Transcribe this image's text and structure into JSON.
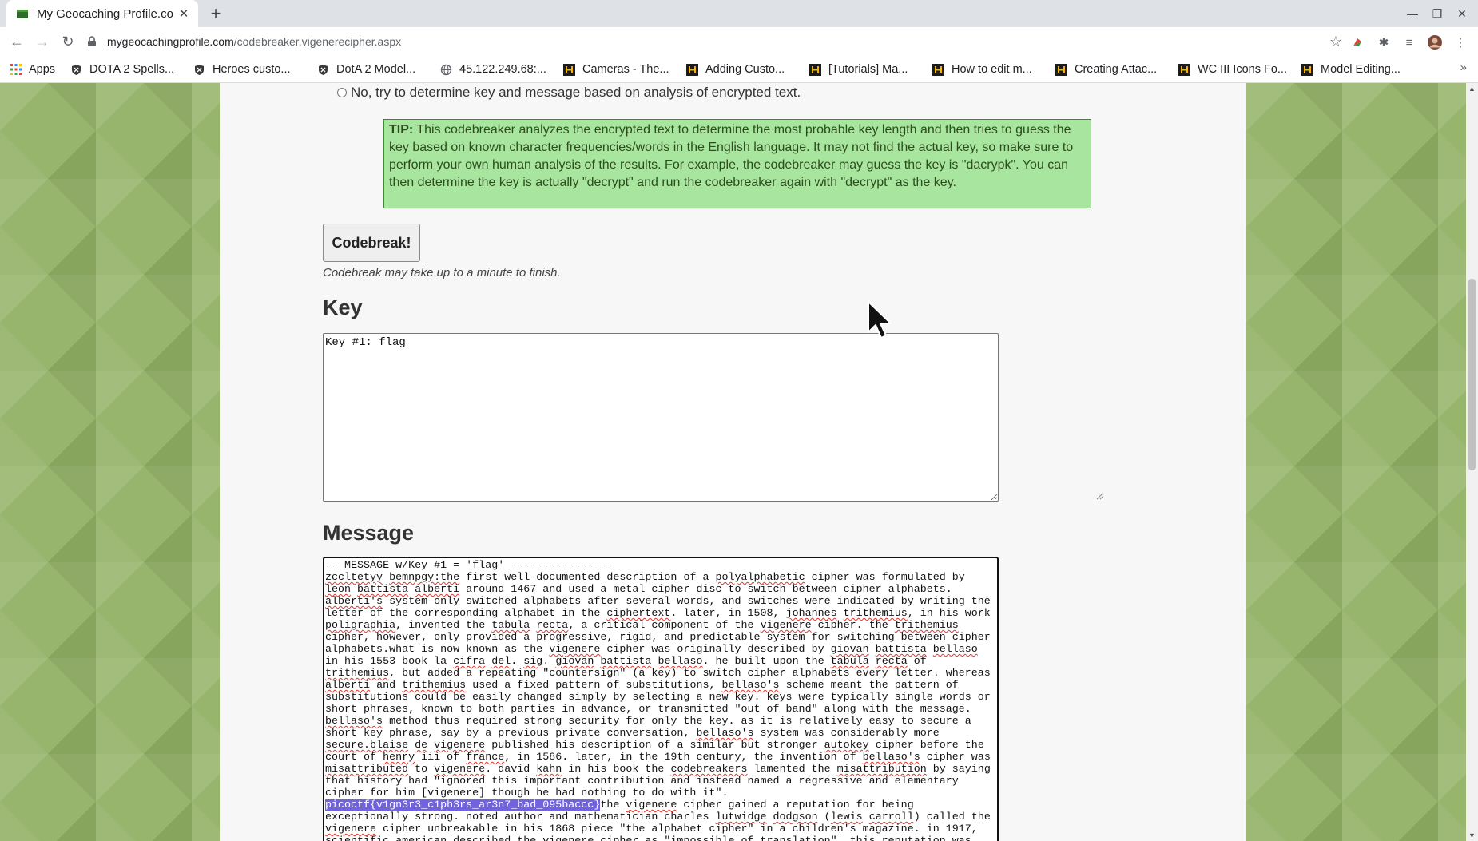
{
  "browser": {
    "tab_title": "My Geocaching Profile.co",
    "url_host": "mygeocachingprofile.com",
    "url_path": "/codebreaker.vigenerecipher.aspx",
    "bookmarks": [
      {
        "label": "Apps",
        "icon": "apps-grid-icon"
      },
      {
        "label": "DOTA 2 Spells...",
        "icon": "dota-shield-icon"
      },
      {
        "label": "Heroes custo...",
        "icon": "dota-shield-icon"
      },
      {
        "label": "DotA 2 Model...",
        "icon": "dota-shield-icon"
      },
      {
        "label": "45.122.249.68:...",
        "icon": "globe-icon"
      },
      {
        "label": "Cameras - The...",
        "icon": "hive-icon"
      },
      {
        "label": "Adding Custo...",
        "icon": "hive-icon"
      },
      {
        "label": "[Tutorials] Ma...",
        "icon": "hive-icon"
      },
      {
        "label": "How to edit m...",
        "icon": "hive-icon"
      },
      {
        "label": "Creating Attac...",
        "icon": "hive-icon"
      },
      {
        "label": "WC III Icons Fo...",
        "icon": "hive-icon"
      },
      {
        "label": "Model Editing...",
        "icon": "hive-icon"
      }
    ],
    "bookmarks_more": "»"
  },
  "page": {
    "radio_label": "No, try to determine key and message based on analysis of encrypted text.",
    "tip_label": "TIP:",
    "tip_text": " This codebreaker analyzes the encrypted text to determine the most probable key length and then tries to guess the key based on known character frequencies/words in the English language.  It may not find the actual key, so make sure to perform your own human analysis of the results.  For example, the codebreaker may guess the key is \"dacrypk\".  You can then determine the key is actually \"decrypt\" and run the codebreaker again with \"decrypt\" as the key.",
    "codebreak_button": "Codebreak!",
    "codebreak_note": "Codebreak may take up to a minute to finish.",
    "key_heading": "Key",
    "key_value": "Key #1: flag",
    "message_heading": "Message",
    "message_lines": [
      "-- MESSAGE w/Key #1 = 'flag' ----------------",
      "zccltetyy bemnpgy:the first well-documented description of a polyalphabetic cipher was formulated by",
      "leon battista alberti around 1467 and used a metal cipher disc to switch between cipher alphabets.",
      "alberti's system only switched alphabets after several words, and switches were indicated by writing the",
      "letter of the corresponding alphabet in the ciphertext. later, in 1508, johannes trithemius, in his work",
      "poligraphia, invented the tabula recta, a critical component of the vigenere cipher. the trithemius",
      "cipher, however, only provided a progressive, rigid, and predictable system for switching between cipher",
      "alphabets.what is now known as the vigenere cipher was originally described by giovan battista bellaso",
      "in his 1553 book la cifra del. sig. giovan battista bellaso. he built upon the tabula recta of",
      "trithemius, but added a repeating \"countersign\" (a key) to switch cipher alphabets every letter. whereas",
      "alberti and trithemius used a fixed pattern of substitutions, bellaso's scheme meant the pattern of",
      "substitutions could be easily changed simply by selecting a new key. keys were typically single words or",
      "short phrases, known to both parties in advance, or transmitted \"out of band\" along with the message.",
      "bellaso's method thus required strong security for only the key. as it is relatively easy to secure a",
      "short key phrase, say by a previous private conversation, bellaso's system was considerably more",
      "secure.blaise de vigenere published his description of a similar but stronger autokey cipher before the",
      "court of henry iii of france, in 1586. later, in the 19th century, the invention of bellaso's cipher was",
      "misattributed to vigenere. david kahn in his book the codebreakers lamented the misattribution by saying",
      "that history had \"ignored this important contribution and instead named a regressive and elementary",
      "cipher for him [vigenere] though he had nothing to do with it\".",
      "picoctf{v1gn3r3_c1ph3rs_ar3n7_bad_095baccc}the vigenere cipher gained a reputation for being",
      "exceptionally strong. noted author and mathematician charles lutwidge dodgson (lewis carroll) called the",
      "vigenere cipher unbreakable in his 1868 piece \"the alphabet cipher\" in a children's magazine. in 1917,",
      "scientific american described the vigenere cipher as \"impossible of translation\". this reputation was"
    ],
    "selected_text": "picoctf{v1gn3r3_c1ph3rs_ar3n7_bad_095baccc}",
    "misspelled_words": [
      "zccltetyy",
      "bemnpgy:the",
      "polyalphabetic",
      "leon",
      "battista",
      "alberti",
      "alberti's",
      "ciphertext",
      "johannes",
      "trithemius",
      "poligraphia",
      "tabula",
      "recta",
      "vigenere",
      "giovan",
      "bellaso",
      "cifra",
      "del",
      "sig",
      "bellaso's",
      "autokey",
      "secure.blaise",
      "de",
      "henry",
      "france",
      "misattributed",
      "kahn",
      "codebreakers",
      "misattribution",
      "lutwidge",
      "dodgson",
      "lewis",
      "carroll"
    ]
  },
  "colors": {
    "tip_background": "#a8e6a0",
    "tip_border": "#3a8a30",
    "selection": "#7163e0",
    "spell_underline": "#e3342f",
    "page_background_green": "#8fae63"
  }
}
